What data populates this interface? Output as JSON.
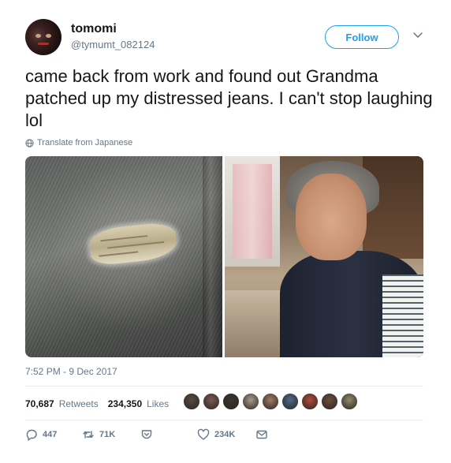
{
  "user": {
    "display_name": "tomomi",
    "handle": "@tymumt_082124"
  },
  "follow_label": "Follow",
  "tweet": {
    "text": "came back from work and found out Grandma patched up my distressed jeans. I can't stop laughing lol",
    "translate_label": "Translate from Japanese",
    "timestamp": "7:52 PM - 9 Dec 2017"
  },
  "stats": {
    "retweets_count": "70,687",
    "retweets_label": "Retweets",
    "likes_count": "234,350",
    "likes_label": "Likes"
  },
  "actions": {
    "reply_count": "447",
    "retweet_count": "71K",
    "like_count": "234K"
  },
  "icons": {
    "more": "chevron-down-icon",
    "translate": "globe-icon",
    "reply": "reply-icon",
    "retweet": "retweet-icon",
    "heart": "heart-icon",
    "dm": "envelope-icon",
    "shield": "shield-icon"
  },
  "colors": {
    "accent": "#1da1f2",
    "text": "#14171a",
    "secondary": "#657786",
    "divider": "#e6ecf0"
  },
  "liker_avatars": [
    {
      "color": "#5a4a45"
    },
    {
      "color": "#7b5a52"
    },
    {
      "color": "#3b3532"
    },
    {
      "color": "#a89b8c"
    },
    {
      "color": "#9e7c62"
    },
    {
      "color": "#4e6a8a"
    },
    {
      "color": "#b04a3a"
    },
    {
      "color": "#6a4f3f"
    },
    {
      "color": "#8f8a6a"
    }
  ]
}
